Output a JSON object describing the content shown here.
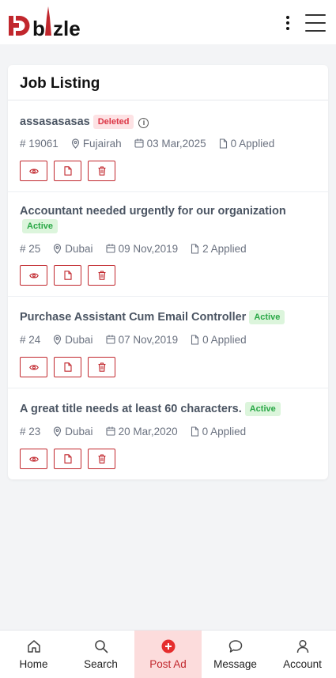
{
  "header": {
    "brand": "Dbizle",
    "brand_color": "#c1272d"
  },
  "card": {
    "title": "Job Listing"
  },
  "jobs": [
    {
      "title": "assasasasas",
      "status": "Deleted",
      "status_type": "deleted",
      "info_icon": true,
      "id": "# 19061",
      "location": "Fujairah",
      "date": "03 Mar,2025",
      "applied": "0 Applied"
    },
    {
      "title": "Accountant needed urgently for our organization",
      "status": "Active",
      "status_type": "active",
      "id": "# 25",
      "location": "Dubai",
      "date": "09 Nov,2019",
      "applied": "2 Applied"
    },
    {
      "title": "Purchase Assistant Cum Email Controller",
      "status": "Active",
      "status_type": "active",
      "id": "# 24",
      "location": "Dubai",
      "date": "07 Nov,2019",
      "applied": "0 Applied"
    },
    {
      "title": "A great title needs at least 60 characters.",
      "status": "Active",
      "status_type": "active",
      "id": "# 23",
      "location": "Dubai",
      "date": "20 Mar,2020",
      "applied": "0 Applied"
    }
  ],
  "nav": {
    "home": "Home",
    "search": "Search",
    "post_ad": "Post Ad",
    "message": "Message",
    "account": "Account"
  },
  "colors": {
    "accent": "#c1272d",
    "active_badge_bg": "#dcf5dc",
    "deleted_badge_bg": "#fde2e4",
    "post_ad_bg": "#fcdcdc"
  }
}
